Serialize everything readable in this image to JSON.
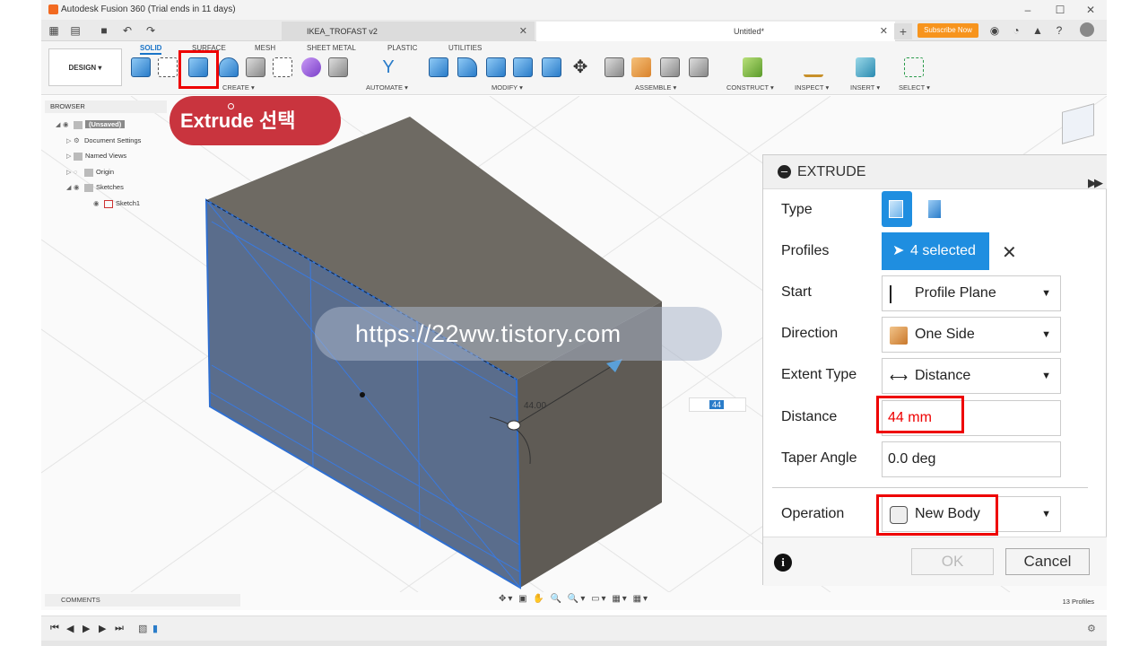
{
  "window": {
    "title": "Autodesk Fusion 360 (Trial ends in 11 days)"
  },
  "tabs": {
    "inactive_tab": "IKEA_TROFAST v2",
    "active_tab": "Untitled*",
    "subscribe": "Subscribe Now"
  },
  "ribbon": {
    "workspace": "DESIGN",
    "tabs": [
      "SOLID",
      "SURFACE",
      "MESH",
      "SHEET METAL",
      "PLASTIC",
      "UTILITIES"
    ],
    "groups": [
      "CREATE",
      "AUTOMATE",
      "MODIFY",
      "ASSEMBLE",
      "CONSTRUCT",
      "INSPECT",
      "INSERT",
      "SELECT"
    ]
  },
  "browser": {
    "title": "BROWSER",
    "root": "(Unsaved)",
    "items": [
      "Document Settings",
      "Named Views",
      "Origin",
      "Sketches",
      "Sketch1"
    ]
  },
  "callout": {
    "text": "Extrude 선택"
  },
  "watermark": {
    "text": "https://22ww.tistory.com"
  },
  "viewport": {
    "dimension": "44.00",
    "input_value": "44"
  },
  "extrude": {
    "title": "EXTRUDE",
    "type_label": "Type",
    "profiles_label": "Profiles",
    "profiles_value": "4 selected",
    "start_label": "Start",
    "start_value": "Profile Plane",
    "direction_label": "Direction",
    "direction_value": "One Side",
    "extent_label": "Extent Type",
    "extent_value": "Distance",
    "distance_label": "Distance",
    "distance_value": "44 mm",
    "taper_label": "Taper Angle",
    "taper_value": "0.0 deg",
    "operation_label": "Operation",
    "operation_value": "New Body",
    "ok": "OK",
    "cancel": "Cancel"
  },
  "status": {
    "comments": "COMMENTS",
    "profiles": "13 Profiles"
  },
  "colors": {
    "accent": "#1f8ee0",
    "highlight": "#e00000",
    "callout": "#c9343e"
  }
}
